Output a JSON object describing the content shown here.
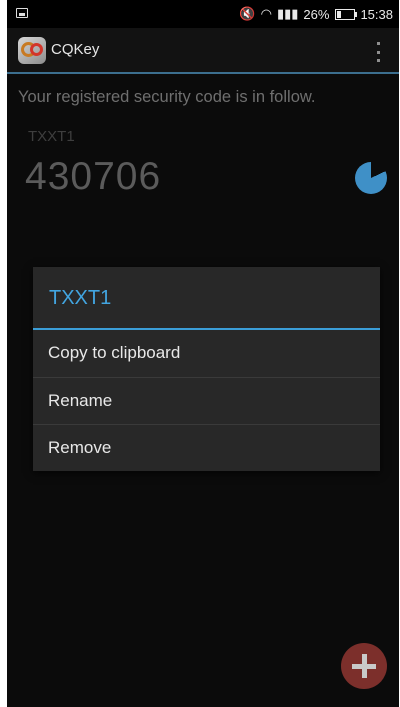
{
  "status_bar": {
    "icons": [
      "image-icon",
      "mute-icon",
      "wifi-icon",
      "signal-icon",
      "battery-icon"
    ],
    "battery_text": "26%",
    "time": "15:38"
  },
  "app_bar": {
    "title": "CQKey",
    "icon": "cqkey-app-icon",
    "overflow_icon": "overflow-menu-icon"
  },
  "main": {
    "intro": "Your registered security code is in follow.",
    "token": {
      "name": "TXXT1",
      "code": "430706",
      "timer_icon": "countdown-timer-icon",
      "accent": "#3f90c7"
    }
  },
  "dialog": {
    "title": "TXXT1",
    "items": [
      "Copy to clipboard",
      "Rename",
      "Remove"
    ],
    "accent": "#3b9ed8"
  },
  "fab": {
    "icon": "add-icon",
    "color": "#7c2f2b"
  }
}
